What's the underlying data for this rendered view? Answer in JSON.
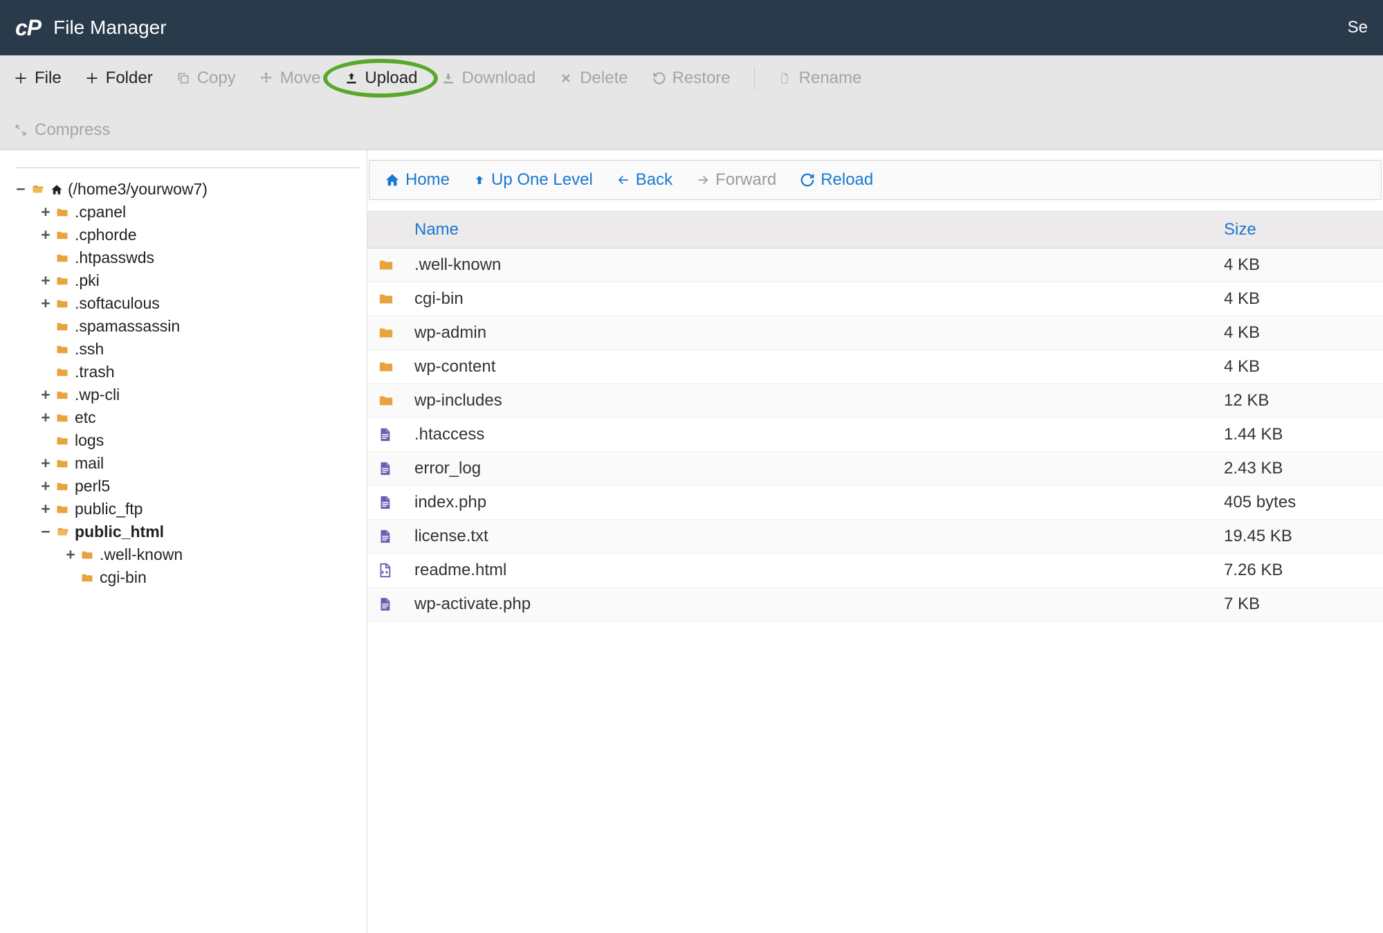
{
  "header": {
    "logo_text": "cP",
    "title": "File Manager",
    "right_text": "Se"
  },
  "toolbar": {
    "items": [
      {
        "label": "File",
        "icon": "plus",
        "enabled": true
      },
      {
        "label": "Folder",
        "icon": "plus",
        "enabled": true
      },
      {
        "label": "Copy",
        "icon": "copy",
        "enabled": false
      },
      {
        "label": "Move",
        "icon": "move",
        "enabled": false
      },
      {
        "label": "Upload",
        "icon": "upload",
        "enabled": true,
        "highlighted": true
      },
      {
        "label": "Download",
        "icon": "download",
        "enabled": false
      },
      {
        "label": "Delete",
        "icon": "delete",
        "enabled": false
      },
      {
        "label": "Restore",
        "icon": "restore",
        "enabled": false
      },
      {
        "label": "SEP"
      },
      {
        "label": "Rename",
        "icon": "rename",
        "enabled": false
      },
      {
        "label": "Compress",
        "icon": "compress",
        "enabled": false,
        "wrap": true
      }
    ]
  },
  "tree": {
    "items": [
      {
        "toggle": "−",
        "indent": 0,
        "icon": "folder-open",
        "extra_icon": "home",
        "label": "(/home3/yourwow7)"
      },
      {
        "toggle": "+",
        "indent": 1,
        "icon": "folder",
        "label": ".cpanel"
      },
      {
        "toggle": "+",
        "indent": 1,
        "icon": "folder",
        "label": ".cphorde"
      },
      {
        "toggle": "",
        "indent": 1,
        "icon": "folder",
        "label": ".htpasswds"
      },
      {
        "toggle": "+",
        "indent": 1,
        "icon": "folder",
        "label": ".pki"
      },
      {
        "toggle": "+",
        "indent": 1,
        "icon": "folder",
        "label": ".softaculous"
      },
      {
        "toggle": "",
        "indent": 1,
        "icon": "folder",
        "label": ".spamassassin"
      },
      {
        "toggle": "",
        "indent": 1,
        "icon": "folder",
        "label": ".ssh"
      },
      {
        "toggle": "",
        "indent": 1,
        "icon": "folder",
        "label": ".trash"
      },
      {
        "toggle": "+",
        "indent": 1,
        "icon": "folder",
        "label": ".wp-cli"
      },
      {
        "toggle": "+",
        "indent": 1,
        "icon": "folder",
        "label": "etc"
      },
      {
        "toggle": "",
        "indent": 1,
        "icon": "folder",
        "label": "logs"
      },
      {
        "toggle": "+",
        "indent": 1,
        "icon": "folder",
        "label": "mail"
      },
      {
        "toggle": "+",
        "indent": 1,
        "icon": "folder",
        "label": "perl5"
      },
      {
        "toggle": "+",
        "indent": 1,
        "icon": "folder",
        "label": "public_ftp"
      },
      {
        "toggle": "−",
        "indent": 1,
        "icon": "folder-open",
        "label": "public_html",
        "bold": true
      },
      {
        "toggle": "+",
        "indent": 2,
        "icon": "folder",
        "label": ".well-known"
      },
      {
        "toggle": "",
        "indent": 2,
        "icon": "folder",
        "label": "cgi-bin"
      }
    ]
  },
  "nav": {
    "home": "Home",
    "up": "Up One Level",
    "back": "Back",
    "forward": "Forward",
    "reload": "Reload"
  },
  "table": {
    "columns": {
      "name": "Name",
      "size": "Size"
    },
    "rows": [
      {
        "icon": "folder",
        "name": ".well-known",
        "size": "4 KB"
      },
      {
        "icon": "folder",
        "name": "cgi-bin",
        "size": "4 KB"
      },
      {
        "icon": "folder",
        "name": "wp-admin",
        "size": "4 KB"
      },
      {
        "icon": "folder",
        "name": "wp-content",
        "size": "4 KB"
      },
      {
        "icon": "folder",
        "name": "wp-includes",
        "size": "12 KB"
      },
      {
        "icon": "file",
        "name": ".htaccess",
        "size": "1.44 KB"
      },
      {
        "icon": "file",
        "name": "error_log",
        "size": "2.43 KB"
      },
      {
        "icon": "file",
        "name": "index.php",
        "size": "405 bytes"
      },
      {
        "icon": "file",
        "name": "license.txt",
        "size": "19.45 KB"
      },
      {
        "icon": "file-code",
        "name": "readme.html",
        "size": "7.26 KB"
      },
      {
        "icon": "file",
        "name": "wp-activate.php",
        "size": "7 KB"
      }
    ]
  }
}
